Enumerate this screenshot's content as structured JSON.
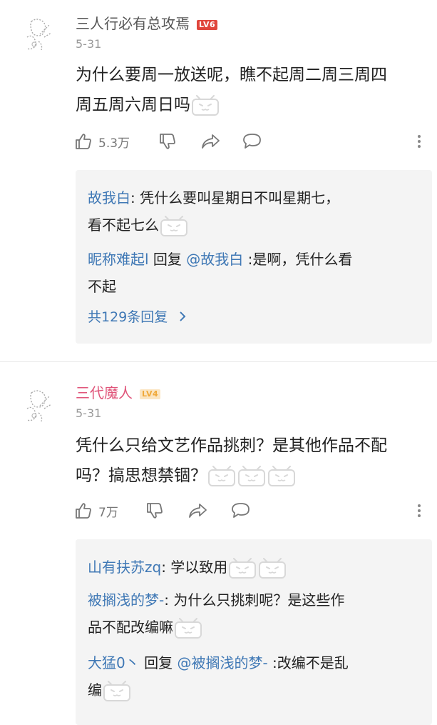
{
  "comments": [
    {
      "username": "三人行必有总攻焉",
      "level": "LV6",
      "level_color": "#e0463c",
      "date": "5-31",
      "text_line1": "为什么要周一放送呢，瞧不起周二周三周四",
      "text_line2": "周五周六周日吗",
      "likes": "5.3万",
      "replies": [
        {
          "user": "故我白",
          "text_line1": ": 凭什么要叫星期日不叫星期七，",
          "text_line2": "看不起七么"
        },
        {
          "user": "昵称难起l",
          "reply_word": " 回复 ",
          "mention": "@故我白",
          "text_line1": " :是啊，凭什么看",
          "text_line2": "不起"
        }
      ],
      "more_replies": "共129条回复"
    },
    {
      "username": "三代魔人",
      "level": "LV4",
      "level_color": "#f0a93a",
      "username_color": "#e0557a",
      "date": "5-31",
      "text_line1": "凭什么只给文艺作品挑刺？是其他作品不配",
      "text_line2": "吗？搞思想禁锢？",
      "likes": "7万",
      "replies": [
        {
          "user": "山有扶苏zq",
          "text_line1": ": 学以致用"
        },
        {
          "user": "被搁浅的梦-",
          "text_line1": ": 为什么只挑刺呢？是这些作",
          "text_line2": "品不配改编嘛"
        },
        {
          "user": "大猛0丶",
          "reply_word": " 回复 ",
          "mention": "@被搁浅的梦-",
          "text_line1": " :改编不是乱",
          "text_line2": "编"
        }
      ]
    }
  ]
}
